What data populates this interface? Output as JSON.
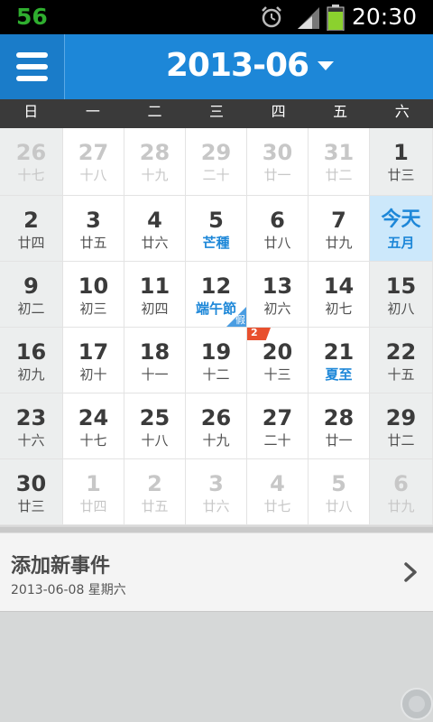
{
  "status_bar": {
    "notification_count": "56",
    "time": "20:30",
    "icons": [
      "alarm-icon",
      "signal-icon",
      "battery-icon"
    ],
    "colors": {
      "notification": "#2fae2f",
      "battery": "#8bd12e"
    }
  },
  "header": {
    "month_title": "2013-06",
    "menu_icon": "hamburger-menu-icon",
    "dropdown_icon": "dropdown-triangle-icon",
    "accent_color": "#1d87d8"
  },
  "weekdays": [
    "日",
    "一",
    "二",
    "三",
    "四",
    "五",
    "六"
  ],
  "weeks": [
    [
      {
        "day": "26",
        "lunar": "十七",
        "other": true
      },
      {
        "day": "27",
        "lunar": "十八",
        "other": true
      },
      {
        "day": "28",
        "lunar": "十九",
        "other": true
      },
      {
        "day": "29",
        "lunar": "二十",
        "other": true
      },
      {
        "day": "30",
        "lunar": "廿一",
        "other": true
      },
      {
        "day": "31",
        "lunar": "廿二",
        "other": true
      },
      {
        "day": "1",
        "lunar": "廿三"
      }
    ],
    [
      {
        "day": "2",
        "lunar": "廿四"
      },
      {
        "day": "3",
        "lunar": "廿五"
      },
      {
        "day": "4",
        "lunar": "廿六"
      },
      {
        "day": "5",
        "lunar": "芒種",
        "term": true
      },
      {
        "day": "6",
        "lunar": "廿八"
      },
      {
        "day": "7",
        "lunar": "廿九"
      },
      {
        "day": "今天",
        "lunar": "五月",
        "today": true
      }
    ],
    [
      {
        "day": "9",
        "lunar": "初二"
      },
      {
        "day": "10",
        "lunar": "初三"
      },
      {
        "day": "11",
        "lunar": "初四"
      },
      {
        "day": "12",
        "lunar": "端午節",
        "term": true,
        "holiday": "假"
      },
      {
        "day": "13",
        "lunar": "初六"
      },
      {
        "day": "14",
        "lunar": "初七"
      },
      {
        "day": "15",
        "lunar": "初八"
      }
    ],
    [
      {
        "day": "16",
        "lunar": "初九"
      },
      {
        "day": "17",
        "lunar": "初十"
      },
      {
        "day": "18",
        "lunar": "十一"
      },
      {
        "day": "19",
        "lunar": "十二"
      },
      {
        "day": "20",
        "lunar": "十三",
        "badge": "2"
      },
      {
        "day": "21",
        "lunar": "夏至",
        "term": true
      },
      {
        "day": "22",
        "lunar": "十五"
      }
    ],
    [
      {
        "day": "23",
        "lunar": "十六"
      },
      {
        "day": "24",
        "lunar": "十七"
      },
      {
        "day": "25",
        "lunar": "十八"
      },
      {
        "day": "26",
        "lunar": "十九"
      },
      {
        "day": "27",
        "lunar": "二十"
      },
      {
        "day": "28",
        "lunar": "廿一"
      },
      {
        "day": "29",
        "lunar": "廿二"
      }
    ],
    [
      {
        "day": "30",
        "lunar": "廿三"
      },
      {
        "day": "1",
        "lunar": "廿四",
        "other": true
      },
      {
        "day": "2",
        "lunar": "廿五",
        "other": true
      },
      {
        "day": "3",
        "lunar": "廿六",
        "other": true
      },
      {
        "day": "4",
        "lunar": "廿七",
        "other": true
      },
      {
        "day": "5",
        "lunar": "廿八",
        "other": true
      },
      {
        "day": "6",
        "lunar": "廿九",
        "other": true
      }
    ]
  ],
  "add_event": {
    "title": "添加新事件",
    "date": "2013-06-08 星期六",
    "chevron_icon": "chevron-right-icon"
  }
}
